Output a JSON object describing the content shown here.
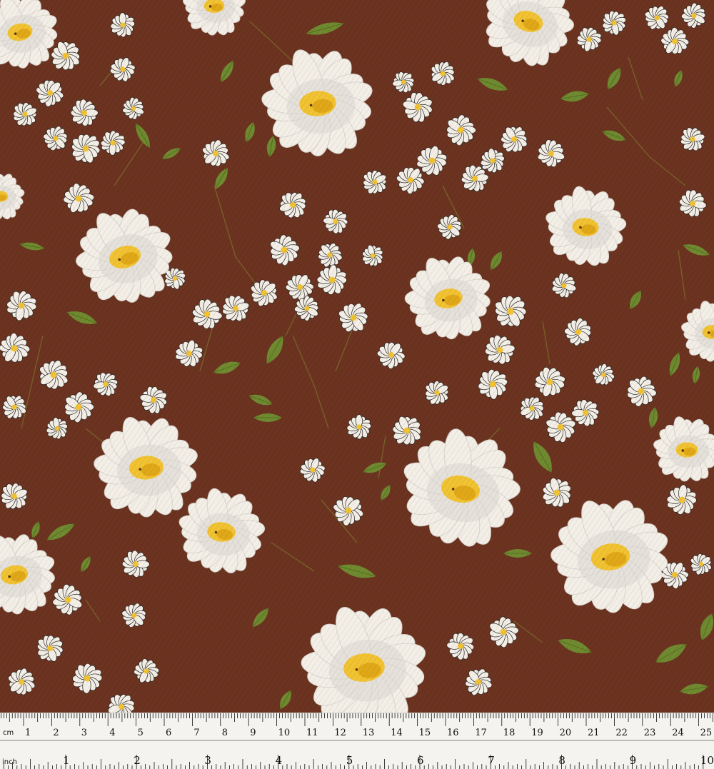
{
  "colors": {
    "fabric_background": "#6b3320",
    "petal": "#f3eee6",
    "petal_shadow": "#d9d6d0",
    "center": "#f1c232",
    "center_shadow": "#e0a818",
    "leaf": "#6f8a30",
    "stem": "#7d6a2a",
    "small_flower_outline": "#2a2a2a",
    "ruler_background": "#f4f3ef",
    "ruler_ink": "#111111"
  },
  "ruler": {
    "cm_unit": "cm",
    "inch_unit": "inch",
    "cm_labels": [
      "1",
      "2",
      "3",
      "4",
      "5",
      "6",
      "7",
      "8",
      "9",
      "10",
      "11",
      "12",
      "13",
      "14",
      "15",
      "16",
      "17",
      "18",
      "19",
      "20",
      "21",
      "22",
      "23",
      "24",
      "25"
    ],
    "inch_labels": [
      "1",
      "2",
      "3",
      "4",
      "5",
      "6",
      "7",
      "8",
      "9",
      "10"
    ]
  }
}
